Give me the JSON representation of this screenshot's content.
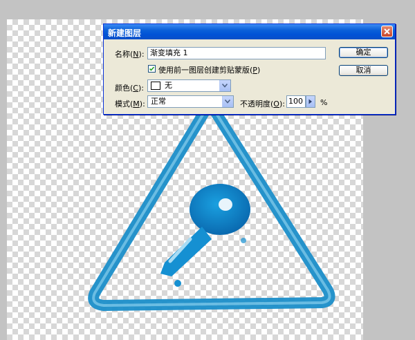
{
  "dialog": {
    "title": "新建图层",
    "name_label": "名称(",
    "name_key": "N",
    "name_label_end": "):",
    "name_value": "渐变填充 1",
    "clip_checked": true,
    "clip_label": "使用前一图层创建剪贴蒙版(",
    "clip_key": "P",
    "clip_label_end": ")",
    "color_label": "颜色(",
    "color_key": "C",
    "color_label_end": "):",
    "color_value": "无",
    "mode_label": "模式(",
    "mode_key": "M",
    "mode_label_end": "):",
    "mode_value": "正常",
    "opacity_label": "不透明度(",
    "opacity_key": "O",
    "opacity_label_end": "):",
    "opacity_value": "100",
    "opacity_unit": "%",
    "ok_label": "确定",
    "cancel_label": "取消"
  },
  "canvas": {
    "artwork": "triangle-key-warning-sign",
    "artwork_color": "#1a8ec8"
  }
}
